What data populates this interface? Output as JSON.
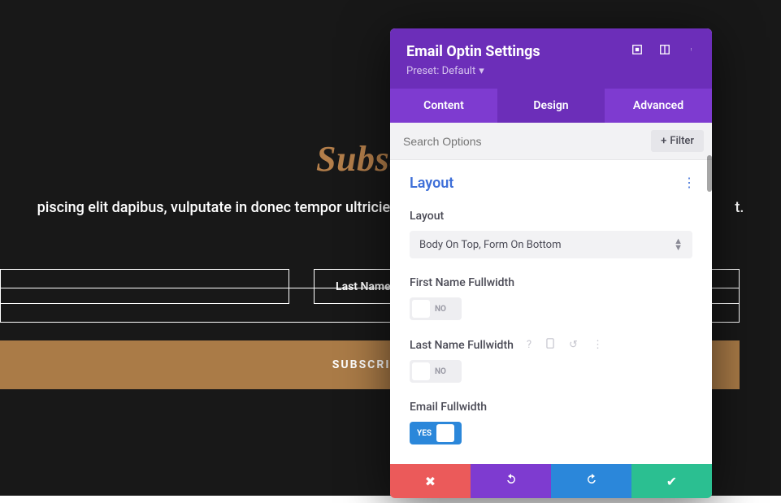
{
  "page": {
    "title": "Subscribe",
    "description": "piscing elit dapibus, vulputate in donec tempor ultricies",
    "description_tail": "t.",
    "first_name_placeholder": "",
    "last_name_placeholder": "Last Name",
    "subscribe_button": "SUBSCRIBE"
  },
  "panel": {
    "title": "Email Optin Settings",
    "preset_label": "Preset: Default",
    "tabs": {
      "content": "Content",
      "design": "Design",
      "advanced": "Advanced",
      "active": "design"
    },
    "search_placeholder": "Search Options",
    "filter_label": "Filter",
    "section_title": "Layout",
    "fields": {
      "layout": {
        "label": "Layout",
        "value": "Body On Top, Form On Bottom"
      },
      "first_name_fullwidth": {
        "label": "First Name Fullwidth",
        "value": "NO",
        "on": false
      },
      "last_name_fullwidth": {
        "label": "Last Name Fullwidth",
        "value": "NO",
        "on": false
      },
      "email_fullwidth": {
        "label": "Email Fullwidth",
        "value": "YES",
        "on": true
      }
    }
  }
}
